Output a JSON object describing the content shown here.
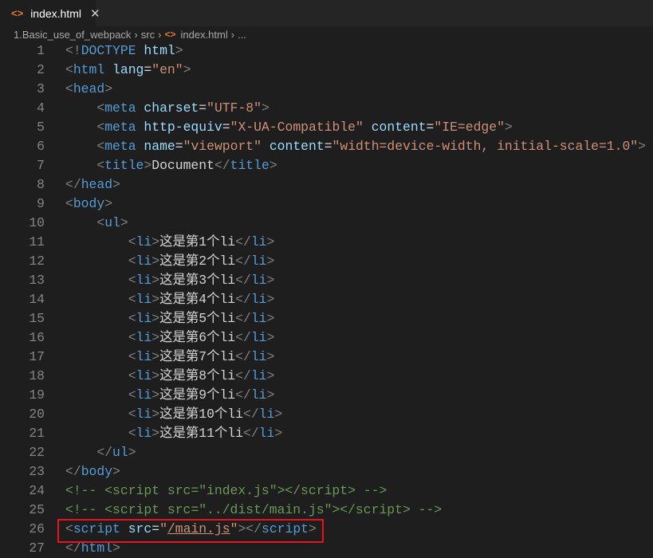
{
  "tab": {
    "label": "index.html",
    "icon": "html-file-icon",
    "close": "✕"
  },
  "breadcrumb": [
    "1.Basic_use_of_webpack",
    "src",
    "index.html",
    "..."
  ],
  "code": [
    [
      [
        "p",
        "<!"
      ],
      [
        "tag",
        "DOCTYPE"
      ],
      [
        "txt",
        " "
      ],
      [
        "attr",
        "html"
      ],
      [
        "p",
        ">"
      ]
    ],
    [
      [
        "p",
        "<"
      ],
      [
        "tag",
        "html"
      ],
      [
        "txt",
        " "
      ],
      [
        "attr",
        "lang"
      ],
      [
        "txt",
        "="
      ],
      [
        "str",
        "\"en\""
      ],
      [
        "p",
        ">"
      ]
    ],
    [
      [
        "p",
        "<"
      ],
      [
        "tag",
        "head"
      ],
      [
        "p",
        ">"
      ]
    ],
    [
      [
        "txt",
        "    "
      ],
      [
        "p",
        "<"
      ],
      [
        "tag",
        "meta"
      ],
      [
        "txt",
        " "
      ],
      [
        "attr",
        "charset"
      ],
      [
        "txt",
        "="
      ],
      [
        "str",
        "\"UTF-8\""
      ],
      [
        "p",
        ">"
      ]
    ],
    [
      [
        "txt",
        "    "
      ],
      [
        "p",
        "<"
      ],
      [
        "tag",
        "meta"
      ],
      [
        "txt",
        " "
      ],
      [
        "attr",
        "http-equiv"
      ],
      [
        "txt",
        "="
      ],
      [
        "str",
        "\"X-UA-Compatible\""
      ],
      [
        "txt",
        " "
      ],
      [
        "attr",
        "content"
      ],
      [
        "txt",
        "="
      ],
      [
        "str",
        "\"IE=edge\""
      ],
      [
        "p",
        ">"
      ]
    ],
    [
      [
        "txt",
        "    "
      ],
      [
        "p",
        "<"
      ],
      [
        "tag",
        "meta"
      ],
      [
        "txt",
        " "
      ],
      [
        "attr",
        "name"
      ],
      [
        "txt",
        "="
      ],
      [
        "str",
        "\"viewport\""
      ],
      [
        "txt",
        " "
      ],
      [
        "attr",
        "content"
      ],
      [
        "txt",
        "="
      ],
      [
        "str",
        "\"width=device-width, initial-scale=1.0\""
      ],
      [
        "p",
        ">"
      ]
    ],
    [
      [
        "txt",
        "    "
      ],
      [
        "p",
        "<"
      ],
      [
        "tag",
        "title"
      ],
      [
        "p",
        ">"
      ],
      [
        "txt",
        "Document"
      ],
      [
        "p",
        "</"
      ],
      [
        "tag",
        "title"
      ],
      [
        "p",
        ">"
      ]
    ],
    [
      [
        "p",
        "</"
      ],
      [
        "tag",
        "head"
      ],
      [
        "p",
        ">"
      ]
    ],
    [
      [
        "p",
        "<"
      ],
      [
        "tag",
        "body"
      ],
      [
        "p",
        ">"
      ]
    ],
    [
      [
        "txt",
        "    "
      ],
      [
        "p",
        "<"
      ],
      [
        "tag",
        "ul"
      ],
      [
        "p",
        ">"
      ]
    ],
    [
      [
        "txt",
        "        "
      ],
      [
        "p",
        "<"
      ],
      [
        "tag",
        "li"
      ],
      [
        "p",
        ">"
      ],
      [
        "txt",
        "这是第1个li"
      ],
      [
        "p",
        "</"
      ],
      [
        "tag",
        "li"
      ],
      [
        "p",
        ">"
      ]
    ],
    [
      [
        "txt",
        "        "
      ],
      [
        "p",
        "<"
      ],
      [
        "tag",
        "li"
      ],
      [
        "p",
        ">"
      ],
      [
        "txt",
        "这是第2个li"
      ],
      [
        "p",
        "</"
      ],
      [
        "tag",
        "li"
      ],
      [
        "p",
        ">"
      ]
    ],
    [
      [
        "txt",
        "        "
      ],
      [
        "p",
        "<"
      ],
      [
        "tag",
        "li"
      ],
      [
        "p",
        ">"
      ],
      [
        "txt",
        "这是第3个li"
      ],
      [
        "p",
        "</"
      ],
      [
        "tag",
        "li"
      ],
      [
        "p",
        ">"
      ]
    ],
    [
      [
        "txt",
        "        "
      ],
      [
        "p",
        "<"
      ],
      [
        "tag",
        "li"
      ],
      [
        "p",
        ">"
      ],
      [
        "txt",
        "这是第4个li"
      ],
      [
        "p",
        "</"
      ],
      [
        "tag",
        "li"
      ],
      [
        "p",
        ">"
      ]
    ],
    [
      [
        "txt",
        "        "
      ],
      [
        "p",
        "<"
      ],
      [
        "tag",
        "li"
      ],
      [
        "p",
        ">"
      ],
      [
        "txt",
        "这是第5个li"
      ],
      [
        "p",
        "</"
      ],
      [
        "tag",
        "li"
      ],
      [
        "p",
        ">"
      ]
    ],
    [
      [
        "txt",
        "        "
      ],
      [
        "p",
        "<"
      ],
      [
        "tag",
        "li"
      ],
      [
        "p",
        ">"
      ],
      [
        "txt",
        "这是第6个li"
      ],
      [
        "p",
        "</"
      ],
      [
        "tag",
        "li"
      ],
      [
        "p",
        ">"
      ]
    ],
    [
      [
        "txt",
        "        "
      ],
      [
        "p",
        "<"
      ],
      [
        "tag",
        "li"
      ],
      [
        "p",
        ">"
      ],
      [
        "txt",
        "这是第7个li"
      ],
      [
        "p",
        "</"
      ],
      [
        "tag",
        "li"
      ],
      [
        "p",
        ">"
      ]
    ],
    [
      [
        "txt",
        "        "
      ],
      [
        "p",
        "<"
      ],
      [
        "tag",
        "li"
      ],
      [
        "p",
        ">"
      ],
      [
        "txt",
        "这是第8个li"
      ],
      [
        "p",
        "</"
      ],
      [
        "tag",
        "li"
      ],
      [
        "p",
        ">"
      ]
    ],
    [
      [
        "txt",
        "        "
      ],
      [
        "p",
        "<"
      ],
      [
        "tag",
        "li"
      ],
      [
        "p",
        ">"
      ],
      [
        "txt",
        "这是第9个li"
      ],
      [
        "p",
        "</"
      ],
      [
        "tag",
        "li"
      ],
      [
        "p",
        ">"
      ]
    ],
    [
      [
        "txt",
        "        "
      ],
      [
        "p",
        "<"
      ],
      [
        "tag",
        "li"
      ],
      [
        "p",
        ">"
      ],
      [
        "txt",
        "这是第10个li"
      ],
      [
        "p",
        "</"
      ],
      [
        "tag",
        "li"
      ],
      [
        "p",
        ">"
      ]
    ],
    [
      [
        "txt",
        "        "
      ],
      [
        "p",
        "<"
      ],
      [
        "tag",
        "li"
      ],
      [
        "p",
        ">"
      ],
      [
        "txt",
        "这是第11个li"
      ],
      [
        "p",
        "</"
      ],
      [
        "tag",
        "li"
      ],
      [
        "p",
        ">"
      ]
    ],
    [
      [
        "txt",
        "    "
      ],
      [
        "p",
        "</"
      ],
      [
        "tag",
        "ul"
      ],
      [
        "p",
        ">"
      ]
    ],
    [
      [
        "p",
        "</"
      ],
      [
        "tag",
        "body"
      ],
      [
        "p",
        ">"
      ]
    ],
    [
      [
        "com",
        "<!-- <script src=\"index.js\"></script> -->"
      ]
    ],
    [
      [
        "com",
        "<!-- <script src=\"../dist/main.js\"></script> -->"
      ]
    ],
    [
      [
        "p",
        "<"
      ],
      [
        "tag",
        "script"
      ],
      [
        "txt",
        " "
      ],
      [
        "attr",
        "src"
      ],
      [
        "txt",
        "="
      ],
      [
        "str",
        "\""
      ],
      [
        "str u",
        "/main.js"
      ],
      [
        "str",
        "\""
      ],
      [
        "p",
        "></"
      ],
      [
        "tag",
        "script"
      ],
      [
        "p",
        ">"
      ]
    ],
    [
      [
        "p",
        "</"
      ],
      [
        "tag",
        "html"
      ],
      [
        "p",
        ">"
      ]
    ]
  ]
}
